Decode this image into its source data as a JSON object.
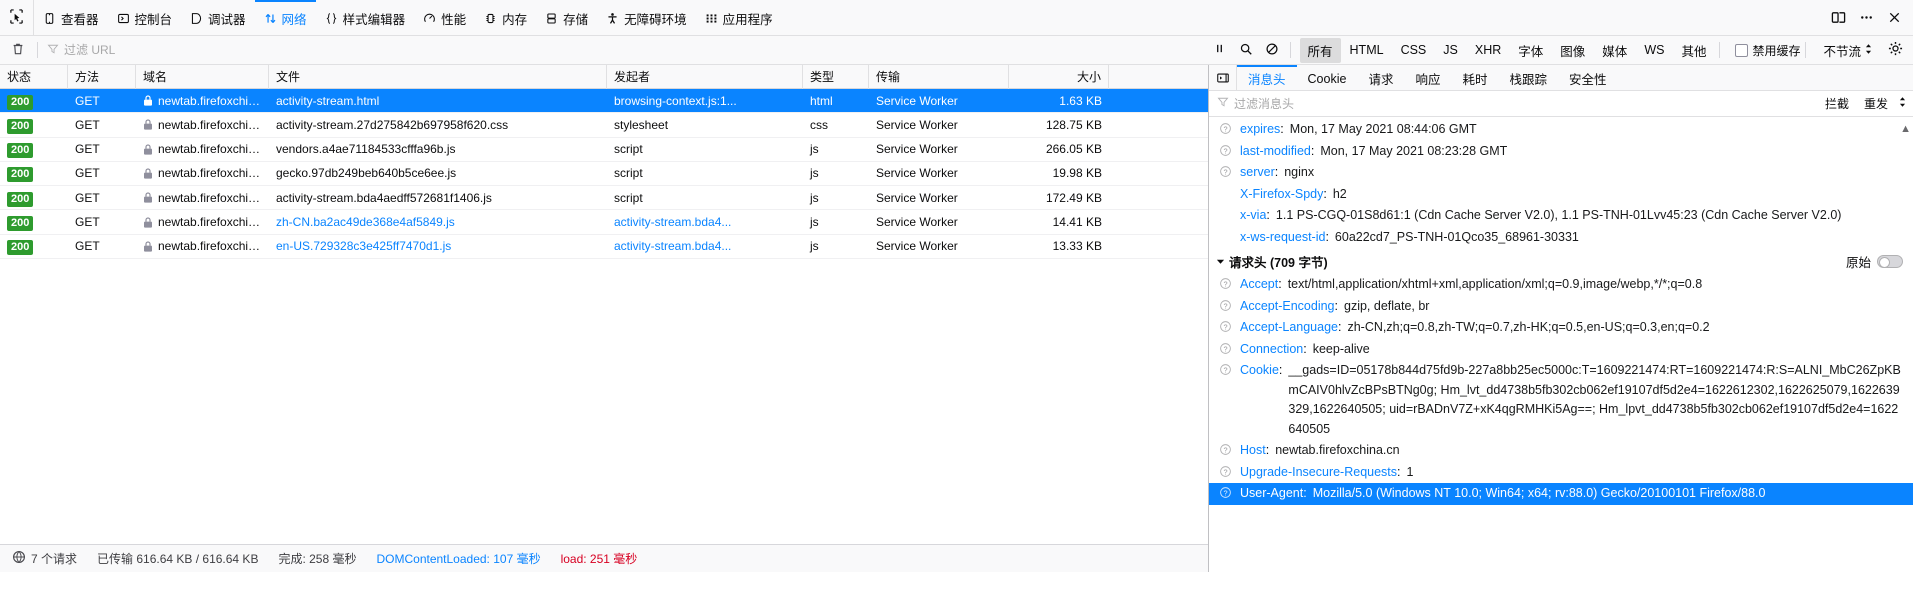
{
  "toolbar": {
    "picker_label": "picker",
    "tabs": [
      {
        "id": "inspector",
        "label": "查看器",
        "icon": "inspector-icon",
        "selected": false
      },
      {
        "id": "console",
        "label": "控制台",
        "icon": "console-icon",
        "selected": false
      },
      {
        "id": "debugger",
        "label": "调试器",
        "icon": "debugger-icon",
        "selected": false
      },
      {
        "id": "network",
        "label": "网络",
        "icon": "network-icon",
        "selected": true
      },
      {
        "id": "style-editor",
        "label": "样式编辑器",
        "icon": "braces-icon",
        "selected": false
      },
      {
        "id": "performance",
        "label": "性能",
        "icon": "performance-icon",
        "selected": false
      },
      {
        "id": "memory",
        "label": "内存",
        "icon": "memory-icon",
        "selected": false
      },
      {
        "id": "storage",
        "label": "存储",
        "icon": "storage-icon",
        "selected": false
      },
      {
        "id": "accessibility",
        "label": "无障碍环境",
        "icon": "accessibility-icon",
        "selected": false
      },
      {
        "id": "application",
        "label": "应用程序",
        "icon": "application-grid-icon",
        "selected": false
      }
    ],
    "right_buttons": [
      {
        "id": "dock",
        "icon": "dock-split-icon"
      },
      {
        "id": "meatball",
        "icon": "ellipsis-icon"
      },
      {
        "id": "close",
        "icon": "close-icon"
      }
    ],
    "accent_color": "#0a84ff"
  },
  "filter_bar": {
    "clear_icon": "trash-icon",
    "filter_icon": "funnel-icon",
    "url_filter_placeholder": "过滤 URL",
    "url_filter_value": "",
    "pause_icon": "pause-icon",
    "search_icon": "search-icon",
    "block_icon": "block-icon",
    "type_filters": [
      {
        "label": "所有",
        "active": true
      },
      {
        "label": "HTML",
        "active": false
      },
      {
        "label": "CSS",
        "active": false
      },
      {
        "label": "JS",
        "active": false
      },
      {
        "label": "XHR",
        "active": false
      },
      {
        "label": "字体",
        "active": false
      },
      {
        "label": "图像",
        "active": false
      },
      {
        "label": "媒体",
        "active": false
      },
      {
        "label": "WS",
        "active": false
      },
      {
        "label": "其他",
        "active": false
      }
    ],
    "disable_cache_label": "禁用缓存",
    "disable_cache_checked": false,
    "throttle_label": "不节流",
    "settings_icon": "gear-icon"
  },
  "request_table": {
    "columns": [
      {
        "key": "status",
        "label": "状态"
      },
      {
        "key": "method",
        "label": "方法"
      },
      {
        "key": "domain",
        "label": "域名"
      },
      {
        "key": "file",
        "label": "文件"
      },
      {
        "key": "initiator",
        "label": "发起者"
      },
      {
        "key": "type",
        "label": "类型"
      },
      {
        "key": "transferred",
        "label": "传输"
      },
      {
        "key": "size",
        "label": "大小"
      }
    ],
    "rows": [
      {
        "status": "200",
        "method": "GET",
        "domain": "newtab.firefoxchin...",
        "file": "activity-stream.html",
        "initiator": "browsing-context.js:1...",
        "type": "html",
        "transferred": "Service Worker",
        "size": "1.63 KB",
        "selected": true,
        "secure": true,
        "file_link": false
      },
      {
        "status": "200",
        "method": "GET",
        "domain": "newtab.firefoxchin...",
        "file": "activity-stream.27d275842b697958f620.css",
        "initiator": "stylesheet",
        "type": "css",
        "transferred": "Service Worker",
        "size": "128.75 KB",
        "selected": false,
        "secure": true,
        "file_link": false
      },
      {
        "status": "200",
        "method": "GET",
        "domain": "newtab.firefoxchin...",
        "file": "vendors.a4ae71184533cfffa96b.js",
        "initiator": "script",
        "type": "js",
        "transferred": "Service Worker",
        "size": "266.05 KB",
        "selected": false,
        "secure": true,
        "file_link": false
      },
      {
        "status": "200",
        "method": "GET",
        "domain": "newtab.firefoxchin...",
        "file": "gecko.97db249beb640b5ce6ee.js",
        "initiator": "script",
        "type": "js",
        "transferred": "Service Worker",
        "size": "19.98 KB",
        "selected": false,
        "secure": true,
        "file_link": false
      },
      {
        "status": "200",
        "method": "GET",
        "domain": "newtab.firefoxchin...",
        "file": "activity-stream.bda4aedff572681f1406.js",
        "initiator": "script",
        "type": "js",
        "transferred": "Service Worker",
        "size": "172.49 KB",
        "selected": false,
        "secure": true,
        "file_link": false
      },
      {
        "status": "200",
        "method": "GET",
        "domain": "newtab.firefoxchin...",
        "file": "zh-CN.ba2ac49de368e4af5849.js",
        "initiator": "activity-stream.bda4...",
        "type": "js",
        "transferred": "Service Worker",
        "size": "14.41 KB",
        "selected": false,
        "secure": true,
        "file_link": true
      },
      {
        "status": "200",
        "method": "GET",
        "domain": "newtab.firefoxchin...",
        "file": "en-US.729328c3e425ff7470d1.js",
        "initiator": "activity-stream.bda4...",
        "type": "js",
        "transferred": "Service Worker",
        "size": "13.33 KB",
        "selected": false,
        "secure": true,
        "file_link": true
      }
    ]
  },
  "status_bar": {
    "network_icon": "network-status-icon",
    "request_count": "7 个请求",
    "transferred": "已传输 616.64 KB / 616.64 KB",
    "finish": "完成: 258 毫秒",
    "dom_content_loaded": "DOMContentLoaded: 107 毫秒",
    "load": "load: 251 毫秒"
  },
  "details": {
    "back_icon": "panel-toggle-icon",
    "tabs": [
      {
        "label": "消息头",
        "selected": true
      },
      {
        "label": "Cookie",
        "selected": false
      },
      {
        "label": "请求",
        "selected": false
      },
      {
        "label": "响应",
        "selected": false
      },
      {
        "label": "耗时",
        "selected": false
      },
      {
        "label": "栈跟踪",
        "selected": false
      },
      {
        "label": "安全性",
        "selected": false
      }
    ],
    "filter_placeholder": "过滤消息头",
    "filter_value": "",
    "filter_icon": "funnel-icon",
    "block_action": "拦截",
    "resend_action": "重发",
    "response_headers": [
      {
        "name": "expires",
        "value": "Mon, 17 May 2021 08:44:06 GMT",
        "info": true
      },
      {
        "name": "last-modified",
        "value": "Mon, 17 May 2021 08:23:28 GMT",
        "info": true
      },
      {
        "name": "server",
        "value": "nginx",
        "info": true
      },
      {
        "name": "X-Firefox-Spdy",
        "value": "h2",
        "info": false
      },
      {
        "name": "x-via",
        "value": "1.1 PS-CGQ-01S8d61:1 (Cdn Cache Server V2.0), 1.1 PS-TNH-01Lvv45:23 (Cdn Cache Server V2.0)",
        "info": false,
        "wrap": true
      },
      {
        "name": "x-ws-request-id",
        "value": "60a22cd7_PS-TNH-01Qco35_68961-30331",
        "info": false
      }
    ],
    "request_section": {
      "title": "请求头 (709 字节)",
      "raw_label": "原始",
      "raw_enabled": false
    },
    "request_headers": [
      {
        "name": "Accept",
        "value": "text/html,application/xhtml+xml,application/xml;q=0.9,image/webp,*/*;q=0.8",
        "info": true
      },
      {
        "name": "Accept-Encoding",
        "value": "gzip, deflate, br",
        "info": true
      },
      {
        "name": "Accept-Language",
        "value": "zh-CN,zh;q=0.8,zh-TW;q=0.7,zh-HK;q=0.5,en-US;q=0.3,en;q=0.2",
        "info": true
      },
      {
        "name": "Connection",
        "value": "keep-alive",
        "info": true
      },
      {
        "name": "Cookie",
        "value": "__gads=ID=05178b844d75fd9b-227a8bb25ec5000c:T=1609221474:RT=1609221474:R:S=ALNI_MbC26ZpKBmCAIV0hlvZcBPsBTNg0g; Hm_lvt_dd4738b5fb302cb062ef19107df5d2e4=1622612302,1622625079,1622639329,1622640505; uid=rBADnV7Z+xK4qgRMHKi5Ag==; Hm_lpvt_dd4738b5fb302cb062ef19107df5d2e4=1622640505",
        "info": true,
        "wrap": true
      },
      {
        "name": "Host",
        "value": "newtab.firefoxchina.cn",
        "info": true
      },
      {
        "name": "Upgrade-Insecure-Requests",
        "value": "1",
        "info": true
      },
      {
        "name": "User-Agent",
        "value": "Mozilla/5.0 (Windows NT 10.0; Win64; x64; rv:88.0) Gecko/20100101 Firefox/88.0",
        "info": true,
        "wrap": true,
        "highlight": true
      }
    ]
  }
}
